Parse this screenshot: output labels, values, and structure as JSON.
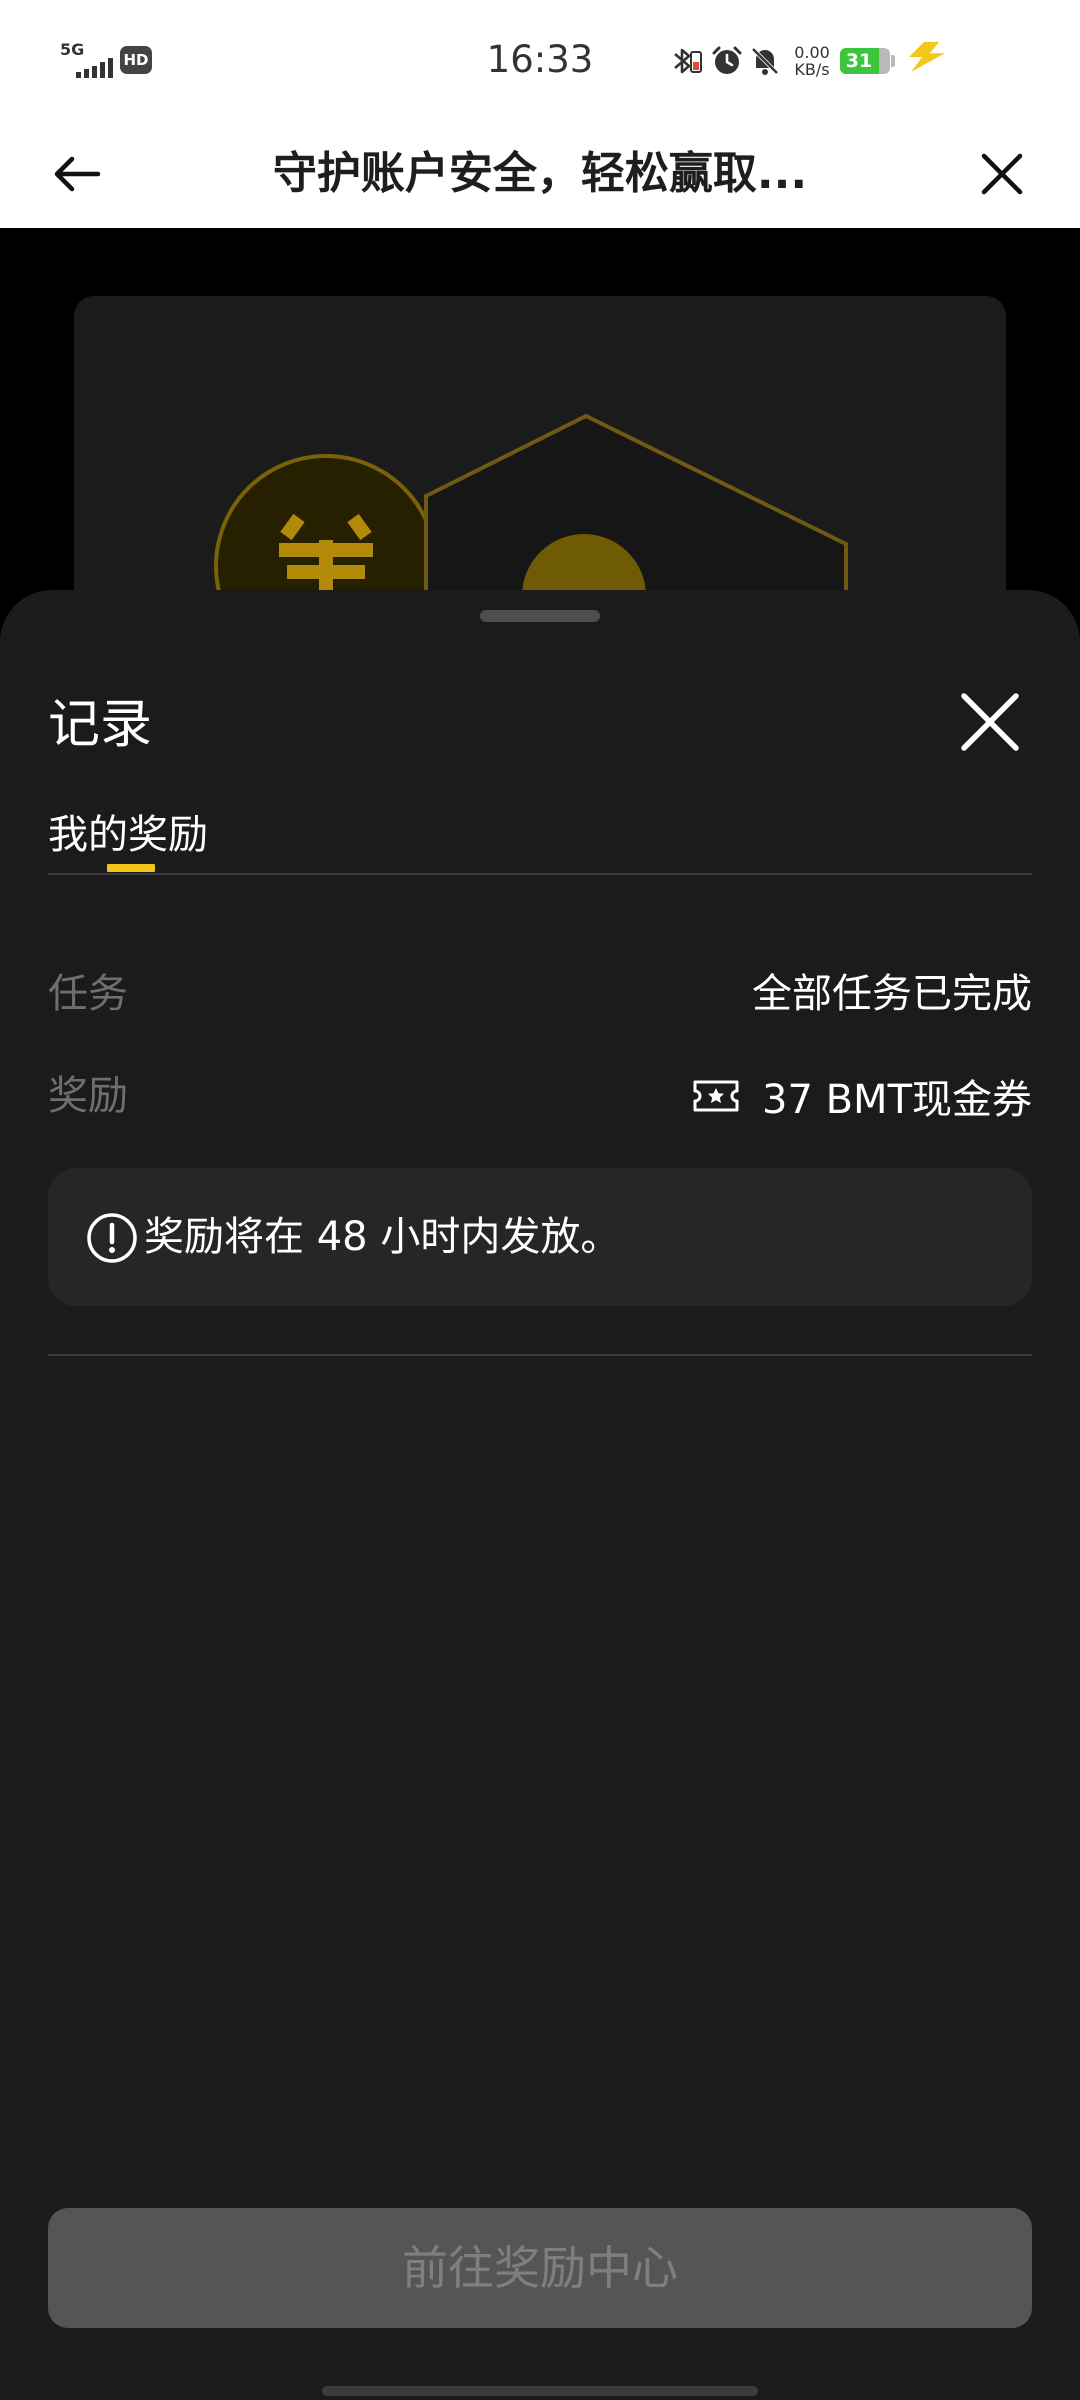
{
  "status_bar": {
    "network": "5G",
    "hd_badge": "HD",
    "time": "16:33",
    "speed_value": "0.00",
    "speed_unit": "KB/s",
    "battery_level": "31",
    "icons": [
      "signal-icon",
      "bluetooth-icon",
      "vibrate-icon",
      "alarm-icon",
      "mute-icon",
      "battery-icon",
      "charging-icon"
    ]
  },
  "nav": {
    "back_icon": "arrow-left-icon",
    "title": "守护账户安全，轻松赢取...",
    "close_icon": "close-icon"
  },
  "sheet": {
    "title": "记录",
    "close_icon": "close-icon",
    "tabs": [
      {
        "label": "我的奖励",
        "active": true
      }
    ],
    "rows": {
      "task": {
        "label": "任务",
        "value": "全部任务已完成"
      },
      "reward": {
        "label": "奖励",
        "icon": "coupon-icon",
        "value": "37 BMT现金券"
      }
    },
    "notice": {
      "icon": "exclamation-circle-icon",
      "text": "奖励将在 48 小时内发放。"
    },
    "cta_label": "前往奖励中心"
  },
  "colors": {
    "sheet_bg": "#1b1b1b",
    "accent": "#f0c419",
    "muted_text": "#6f6f6f",
    "button_bg": "#555555"
  }
}
